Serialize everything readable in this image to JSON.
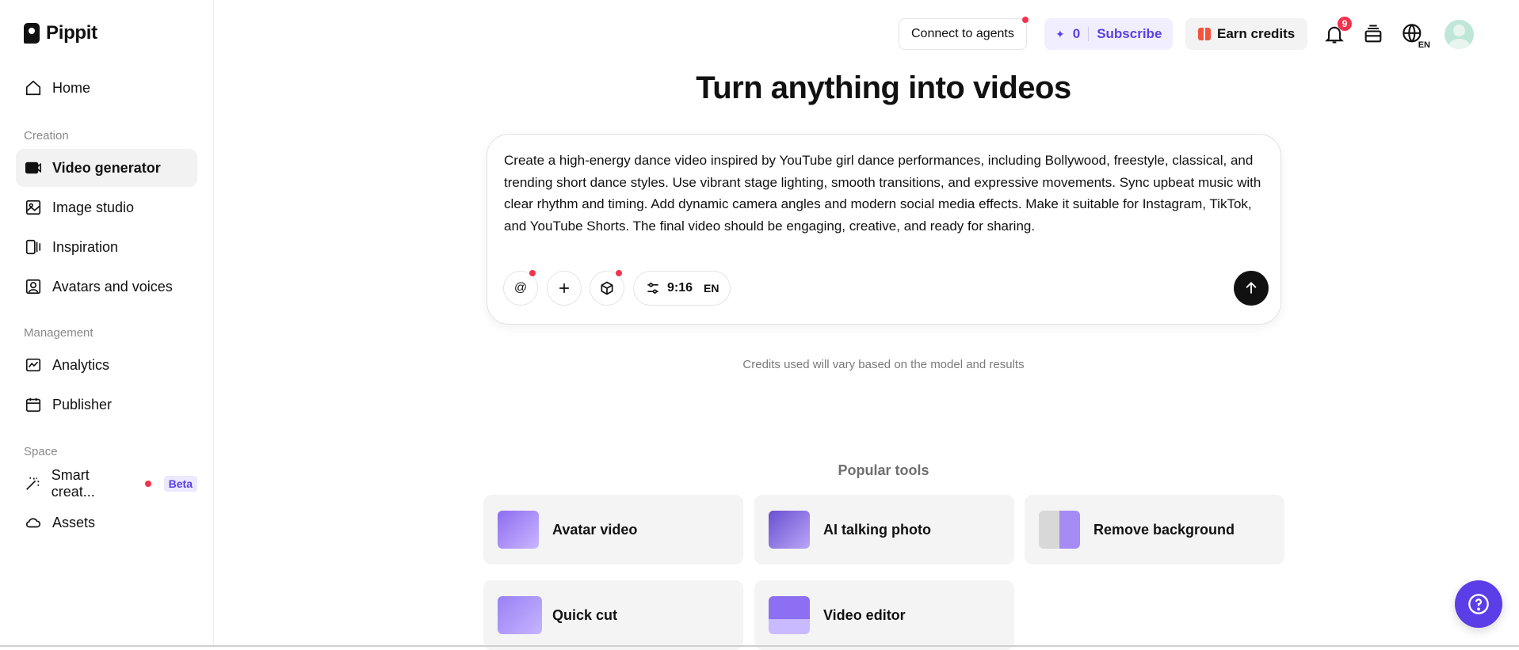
{
  "app": {
    "name": "Pippit"
  },
  "sidebar": {
    "home": "Home",
    "creation_label": "Creation",
    "creation_items": [
      "Video generator",
      "Image studio",
      "Inspiration",
      "Avatars and voices"
    ],
    "management_label": "Management",
    "management_items": [
      "Analytics",
      "Publisher"
    ],
    "space_label": "Space",
    "smart_creation": "Smart creat...",
    "beta": "Beta",
    "assets": "Assets"
  },
  "topbar": {
    "connect_agents": "Connect to agents",
    "credits": "0",
    "subscribe": "Subscribe",
    "earn_credits": "Earn credits",
    "notifications_count": "9",
    "language": "EN"
  },
  "main": {
    "headline": "Turn anything into videos",
    "prompt": "Create a high-energy dance video inspired by YouTube girl dance performances, including Bollywood, freestyle, classical, and trending short dance styles. Use vibrant stage lighting, smooth transitions, and expressive movements. Sync upbeat music with clear rhythm and timing. Add dynamic camera angles and modern social media effects. Make it suitable for Instagram, TikTok, and YouTube Shorts. The final video should be engaging, creative, and ready for sharing.",
    "mention_symbol": "@",
    "aspect_ratio": "9:16",
    "lang": "EN",
    "credits_note": "Credits used will vary based on the model and results",
    "popular_tools_title": "Popular tools",
    "tools": [
      "Avatar video",
      "AI talking photo",
      "Remove background",
      "Quick cut",
      "Video editor"
    ]
  },
  "colors": {
    "accent": "#5b3ee8",
    "badge_red": "#f2334d"
  }
}
